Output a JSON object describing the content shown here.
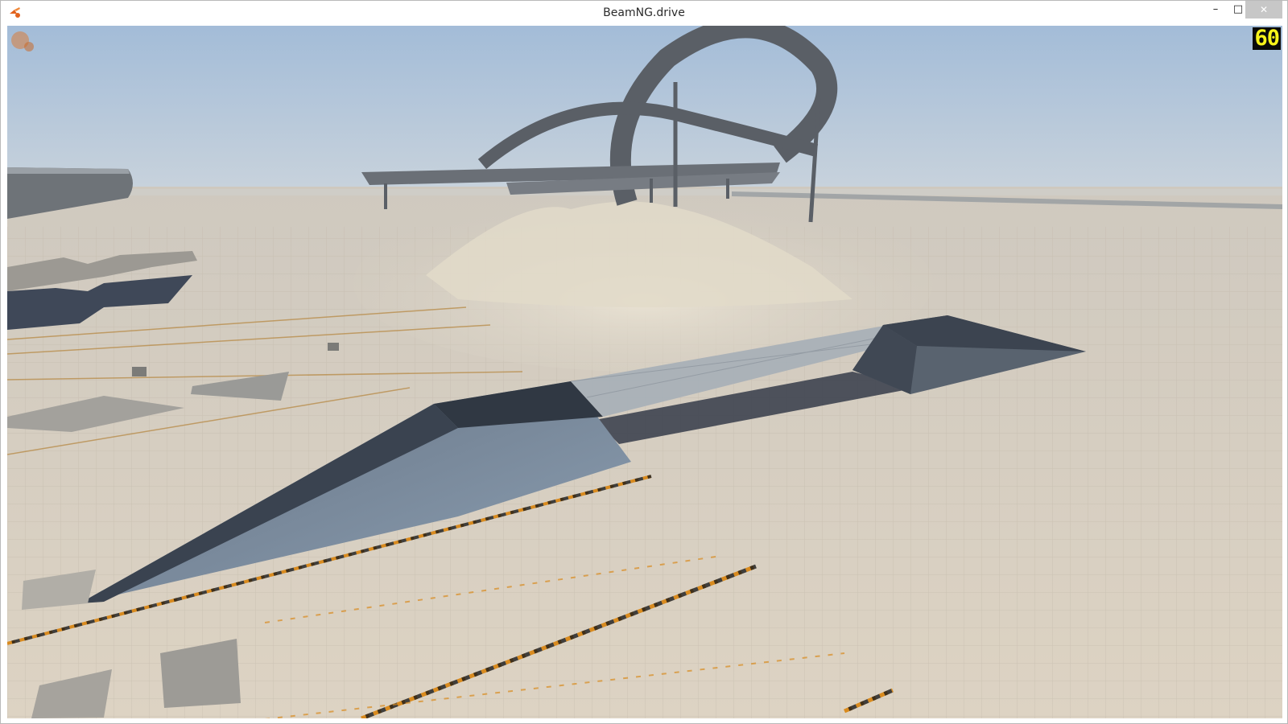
{
  "window": {
    "title": "BeamNG.drive",
    "icon": "beamng-logo-icon",
    "controls": {
      "minimize": "–",
      "maximize": "□",
      "close": "✕"
    }
  },
  "hud": {
    "fps": "60"
  },
  "scene": {
    "sky_color": "#a9c0d8",
    "ground_color": "#d8d0c2",
    "ramp_color": "#4b5664",
    "accent_stripe_color": "#e89a22"
  }
}
